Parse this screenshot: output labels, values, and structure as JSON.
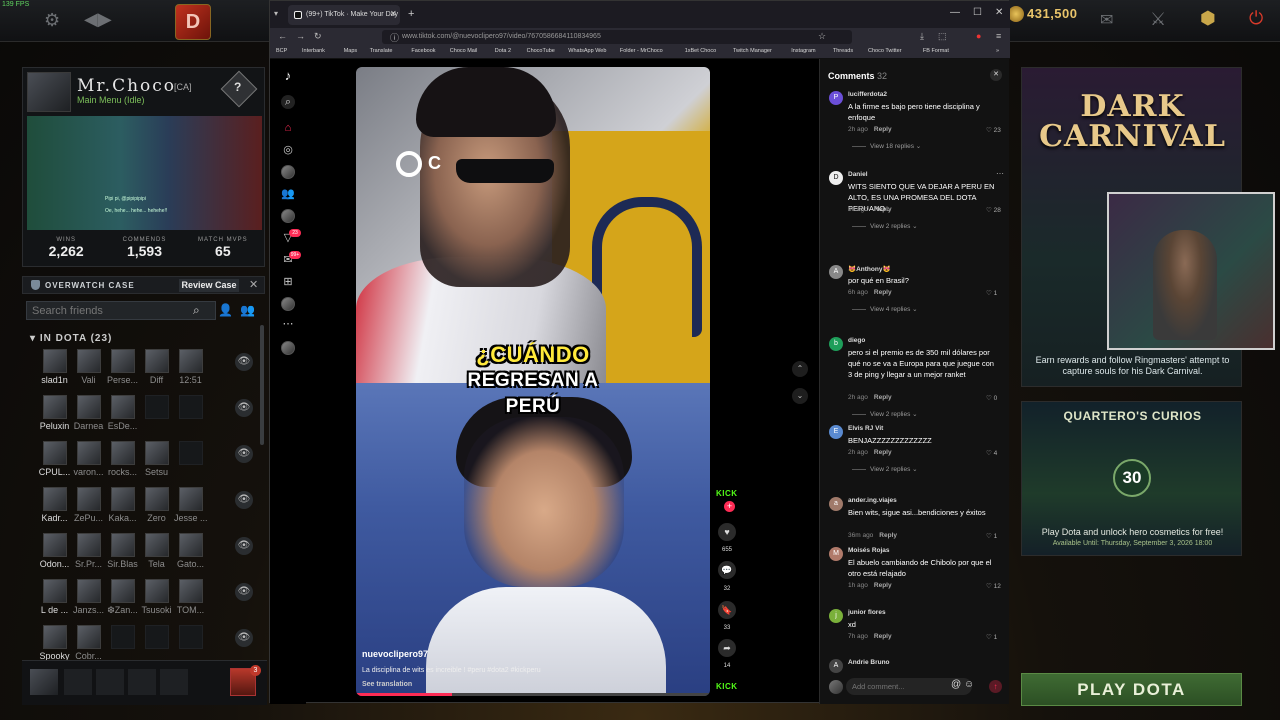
{
  "topbar": {
    "fps": "139 FPS",
    "gold": "431,500"
  },
  "profile": {
    "name": "Mr.Choco",
    "tag": "[CA]",
    "status": "Main Menu (Idle)",
    "rank_glyph": "?",
    "speech1": "Pipi pi, @pipipipipi",
    "speech2": "Oe, hehe... hehe... hehehe!!",
    "stats": [
      {
        "label": "WINS",
        "value": "2,262"
      },
      {
        "label": "COMMENDS",
        "value": "1,593"
      },
      {
        "label": "MATCH MVPS",
        "value": "65"
      }
    ]
  },
  "overwatch": {
    "label": "OVERWATCH CASE",
    "button": "Review Case"
  },
  "friends": {
    "search_placeholder": "Search friends",
    "section": "IN DOTA (23)",
    "rows": [
      [
        "slad1n",
        "Vali",
        "Perse...",
        "Diff",
        "12:51"
      ],
      [
        "Peluxin",
        "Darnea",
        "EsDe...",
        "",
        ""
      ],
      [
        "CPUL...",
        "varon...",
        "rocks...",
        "Setsu",
        ""
      ],
      [
        "Kadr...",
        "ZePu...",
        "Kaka...",
        "Zero",
        "Jesse ..."
      ],
      [
        "Odon...",
        "Sr.Pr...",
        "Sir.Blas",
        "Tela",
        "Gato..."
      ],
      [
        "L de ...",
        "Janzs...",
        "❆Zan...",
        "Tsusoki",
        "TOM..."
      ],
      [
        "Spooky",
        "Cobr...",
        "",
        "",
        ""
      ]
    ]
  },
  "party": {
    "badge": "3"
  },
  "dark_carnival": {
    "title": "DARK CARNIVAL",
    "desc": "Earn rewards and follow Ringmasters' attempt to capture souls for his Dark Carnival."
  },
  "quartero": {
    "title": "QUARTERO'S CURIOS",
    "badge": "30",
    "desc": "Play Dota and unlock hero cosmetics for free!",
    "avail": "Available Until:  Thursday, September 3, 2026 18:00"
  },
  "play_button": "PLAY DOTA",
  "browser": {
    "tab_title": "(99+) TikTok · Make Your Day",
    "url": "www.tiktok.com/@nuevoclipero97/video/7670586684110834965",
    "bookmarks": [
      "BCP",
      "Interbank",
      "Maps",
      "Translate",
      "Facebook",
      "Choco Mail",
      "Dota 2",
      "ChocoTube",
      "WhatsApp Web",
      "Folder - MrChoco",
      "1xBet Choco",
      "Twitch Manager",
      "Instagram",
      "Threads",
      "Choco Twitter",
      "FB Format"
    ]
  },
  "tiktok": {
    "rail_badges": [
      "23",
      "99+"
    ],
    "video": {
      "caption_line1": "¿CUÁNDO",
      "caption_line2": "REGRESAN A",
      "caption_line3": "PERÚ",
      "logo_letter": "C",
      "author": "nuevoclipero97",
      "desc": "La disciplina de wits es increible ! #peru #dota2 #kickperu",
      "translation": "See translation",
      "progress": 0.27
    },
    "actions": {
      "kick_top": "KICK",
      "likes": "655",
      "comments": "32",
      "saves": "33",
      "shares": "14",
      "kick_bottom": "KICK"
    },
    "comments": {
      "title": "Comments",
      "count": "32",
      "input_placeholder": "Add comment...",
      "reply_label": "Reply",
      "items": [
        {
          "initial": "P",
          "color": "#6b4fd8",
          "user": "lucifferdota2",
          "text": "A la firme es bajo pero tiene disciplina y enfoque",
          "time": "2h ago",
          "likes": "♡ 23",
          "replies": "View 18 replies ⌄"
        },
        {
          "initial": "D",
          "color": "#eeeeee",
          "user": "Daniel",
          "text": "WITS SIENTO QUE VA DEJAR A PERU EN ALTO, ES UNA PROMESA DEL DOTA PERUANO .",
          "time": "6h ago",
          "likes": "♡ 28",
          "replies": "View 2 replies ⌄"
        },
        {
          "initial": "A",
          "color": "#888888",
          "user": "😻Anthony😻",
          "text": "por qué en Brasil?",
          "time": "6h ago",
          "likes": "♡ 1",
          "replies": "View 4 replies ⌄"
        },
        {
          "initial": "b",
          "color": "#1e9e5a",
          "user": "diego",
          "text": "pero si el premio es de 350 mil dólares por qué no se va a Europa para que juegue con 3 de ping y llegar a un mejor ranket",
          "time": "2h ago",
          "likes": "♡ 0",
          "replies": "View 2 replies ⌄"
        },
        {
          "initial": "E",
          "color": "#5a8ad0",
          "user": "Elvis RJ Vit",
          "text": "BENJAZZZZZZZZZZZZZ",
          "time": "2h ago",
          "likes": "♡ 4",
          "replies": "View 2 replies ⌄"
        },
        {
          "initial": "a",
          "color": "#a07a6a",
          "user": "ander.ing.viajes",
          "text": "Bien wits, sigue asi...bendiciones y éxitos",
          "time": "36m ago",
          "likes": "♡ 1",
          "replies": ""
        },
        {
          "initial": "M",
          "color": "#b07a6a",
          "user": "Moisés Rojas",
          "text": "El abuelo cambiando de Chibolo por que el otro está relajado",
          "time": "1h ago",
          "likes": "♡ 12",
          "replies": ""
        },
        {
          "initial": "j",
          "color": "#7ab03a",
          "user": "junior flores",
          "text": "xd",
          "time": "7h ago",
          "likes": "♡ 1",
          "replies": ""
        },
        {
          "initial": "A",
          "color": "#444444",
          "user": "Andrie Bruno",
          "text": "",
          "time": "",
          "likes": "",
          "replies": ""
        }
      ]
    }
  },
  "colors": {
    "tiktok_red": "#fe2c55",
    "kick_green": "#53fc18",
    "dota_gold": "#e9c46a"
  }
}
